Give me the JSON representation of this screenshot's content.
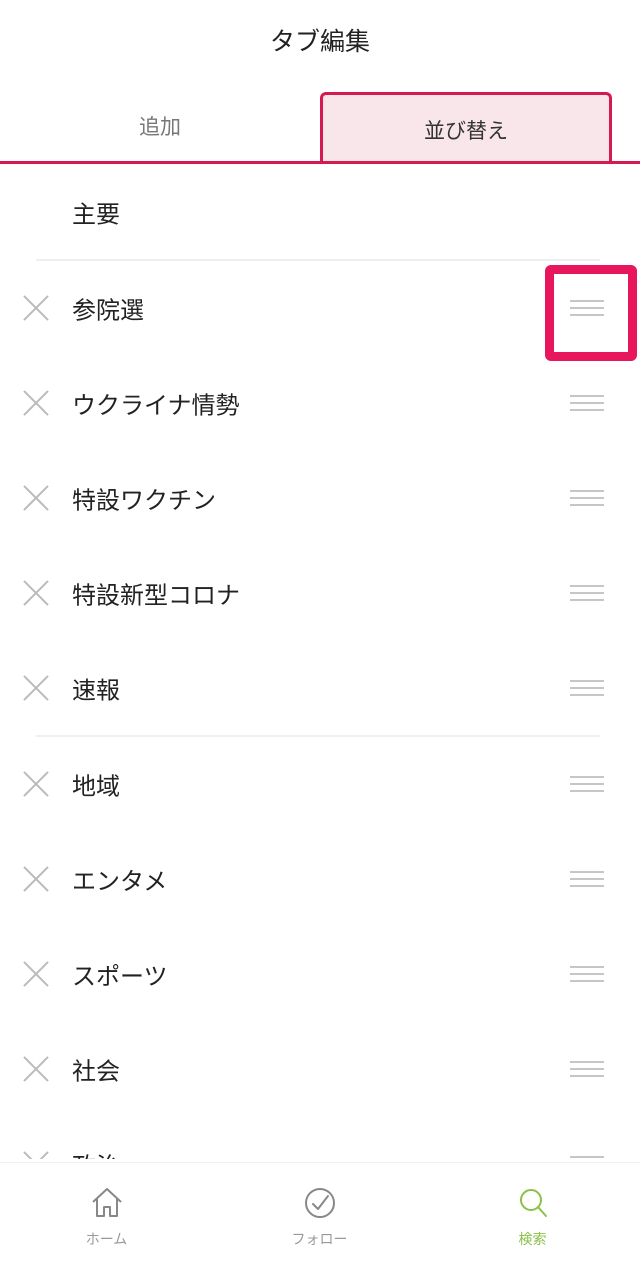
{
  "header": {
    "title": "タブ編集"
  },
  "tabs": [
    {
      "label": "追加",
      "selected": false
    },
    {
      "label": "並び替え",
      "selected": true
    }
  ],
  "list": {
    "items": [
      {
        "label": "主要",
        "removable": false,
        "sortable": false
      },
      {
        "label": "参院選",
        "removable": true,
        "sortable": true
      },
      {
        "label": "ウクライナ情勢",
        "removable": true,
        "sortable": true
      },
      {
        "label": "特設ワクチン",
        "removable": true,
        "sortable": true
      },
      {
        "label": "特設新型コロナ",
        "removable": true,
        "sortable": true
      },
      {
        "label": "速報",
        "removable": true,
        "sortable": true
      },
      {
        "label": "地域",
        "removable": true,
        "sortable": true
      },
      {
        "label": "エンタメ",
        "removable": true,
        "sortable": true
      },
      {
        "label": "スポーツ",
        "removable": true,
        "sortable": true
      },
      {
        "label": "社会",
        "removable": true,
        "sortable": true
      },
      {
        "label": "政治",
        "removable": true,
        "sortable": true
      }
    ]
  },
  "bottom_nav": {
    "items": [
      {
        "label": "ホーム",
        "icon": "home-icon",
        "active": false
      },
      {
        "label": "フォロー",
        "icon": "check-circle-icon",
        "active": false
      },
      {
        "label": "検索",
        "icon": "search-icon",
        "active": true
      }
    ]
  },
  "colors": {
    "accent": "#d51a52",
    "tab_selected_bg": "#f9e6ea",
    "highlight": "#e8175d",
    "nav_active": "#8bc04a"
  }
}
